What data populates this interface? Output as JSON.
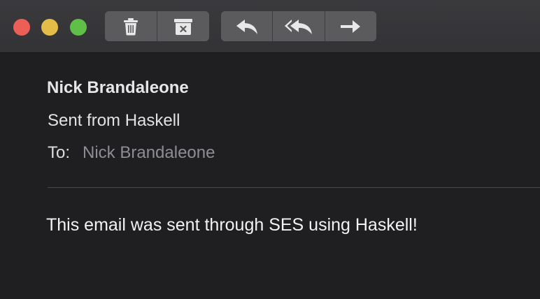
{
  "toolbar": {
    "traffic_lights": [
      {
        "name": "close",
        "color": "#ec5f57"
      },
      {
        "name": "minimize",
        "color": "#e3bd48"
      },
      {
        "name": "zoom",
        "color": "#5fbf47"
      }
    ],
    "button_color": "#5b5b5e",
    "icon_color": "#e8e8e8",
    "icons": [
      "trash-icon",
      "archive-icon",
      "reply-icon",
      "reply-all-icon",
      "forward-icon"
    ]
  },
  "message": {
    "from": "Nick Brandaleone",
    "subject": "Sent from Haskell",
    "to_label": "To:",
    "to_value": "Nick Brandaleone",
    "body": "This email was sent through SES using Haskell!"
  },
  "colors": {
    "background": "#1f1f22",
    "toolbar": "#353538"
  }
}
